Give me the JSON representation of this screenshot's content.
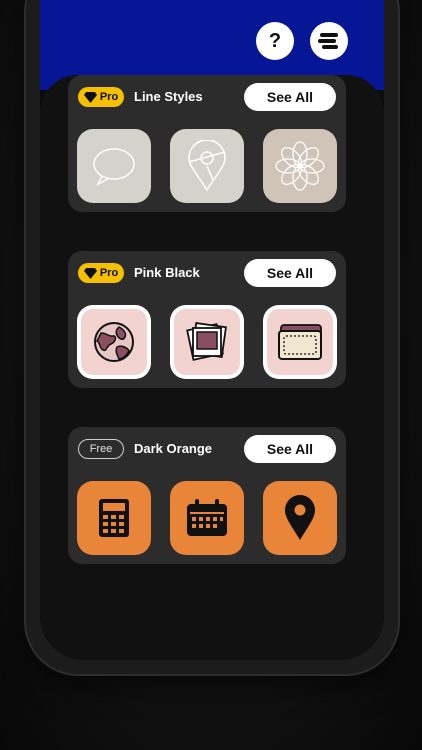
{
  "header": {
    "help_label": "?",
    "help_icon": "question-icon",
    "menu_icon": "menu-icon"
  },
  "packs": [
    {
      "badge": "Pro",
      "title": "Line Styles",
      "see_all": "See All",
      "icons": [
        "chat-bubble-icon",
        "map-pin-icon",
        "flower-icon"
      ]
    },
    {
      "badge": "Pro",
      "title": "Pink Black",
      "see_all": "See All",
      "icons": [
        "globe-icon",
        "photos-icon",
        "wallet-icon"
      ]
    },
    {
      "badge": "Free",
      "title": "Dark Orange",
      "see_all": "See All",
      "icons": [
        "calculator-icon",
        "calendar-icon",
        "map-pin-icon"
      ]
    }
  ],
  "colors": {
    "header_blue": "#071695",
    "pro_yellow": "#f4c000",
    "orange": "#e98538",
    "pink": "#f2d3d0"
  }
}
